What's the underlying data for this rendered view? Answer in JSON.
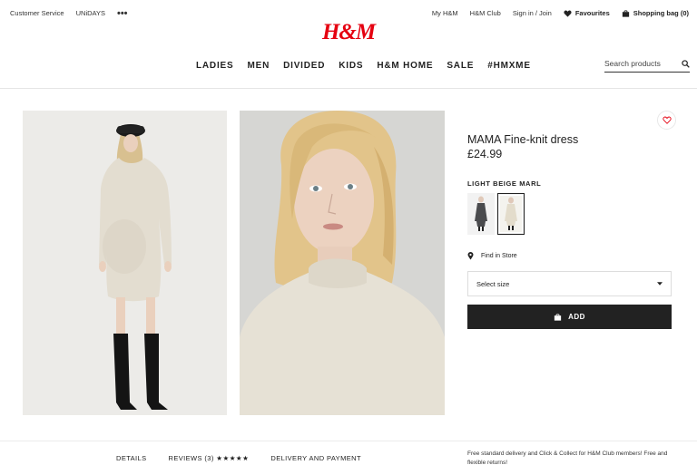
{
  "top_bar": {
    "customer_service": "Customer Service",
    "unidays": "UNiDAYS",
    "more": "•••",
    "my_hm": "My H&M",
    "hm_club": "H&M Club",
    "sign_in": "Sign in / Join",
    "favourites": "Favourites",
    "shopping_bag": "Shopping bag (0)"
  },
  "logo": {
    "text": "H&M",
    "color": "#e50010"
  },
  "nav": {
    "items": [
      {
        "label": "LADIES"
      },
      {
        "label": "MEN"
      },
      {
        "label": "DIVIDED"
      },
      {
        "label": "KIDS"
      },
      {
        "label": "H&M HOME"
      },
      {
        "label": "SALE"
      },
      {
        "label": "#HMXME"
      }
    ]
  },
  "search": {
    "placeholder": "Search products",
    "icon": "search-icon"
  },
  "product": {
    "title": "MAMA Fine-knit dress",
    "price": "£24.99",
    "color_label": "LIGHT BEIGE MARL",
    "find_in_store": "Find in Store",
    "size_select": "Select size",
    "add_button": "ADD"
  },
  "bottom": {
    "details": "DETAILS",
    "reviews": "REVIEWS (3)",
    "stars": "★★★★★",
    "delivery_tab": "DELIVERY AND PAYMENT",
    "delivery_note": "Free standard delivery and Click & Collect for H&M Club members! Free and flexible returns!"
  },
  "colors": {
    "brand_red": "#e50010",
    "button_dark": "#222222",
    "dress_beige": "#e6e1d5"
  }
}
